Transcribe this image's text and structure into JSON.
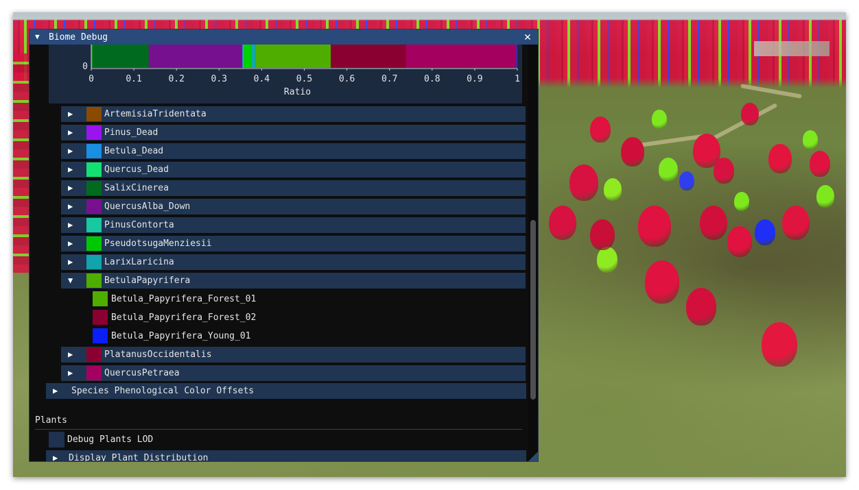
{
  "window": {
    "title": "Biome Debug",
    "close_label": "✕",
    "collapse_arrow": "▼"
  },
  "chart_data": {
    "type": "bar",
    "orientation": "horizontal-stacked",
    "xlabel": "Ratio",
    "xlim": [
      0,
      1
    ],
    "x_ticks": [
      "0",
      "0.1",
      "0.2",
      "0.3",
      "0.4",
      "0.5",
      "0.6",
      "0.7",
      "0.8",
      "0.9",
      "1"
    ],
    "y_tick": "0",
    "segments": [
      {
        "start": 0.0,
        "end": 0.003,
        "color": "#1fa51f"
      },
      {
        "start": 0.003,
        "end": 0.135,
        "color": "#006b1f"
      },
      {
        "start": 0.135,
        "end": 0.355,
        "color": "#77108f"
      },
      {
        "start": 0.355,
        "end": 0.358,
        "color": "#00cfd8"
      },
      {
        "start": 0.358,
        "end": 0.375,
        "color": "#00d200"
      },
      {
        "start": 0.375,
        "end": 0.385,
        "color": "#12a8a8"
      },
      {
        "start": 0.385,
        "end": 0.562,
        "color": "#4fad00"
      },
      {
        "start": 0.562,
        "end": 0.738,
        "color": "#8a0030"
      },
      {
        "start": 0.738,
        "end": 0.998,
        "color": "#a4005f"
      },
      {
        "start": 0.998,
        "end": 1.0,
        "color": "#0a3cf0"
      }
    ]
  },
  "species": [
    {
      "name": "ArtemisiaTridentata",
      "color": "#8a4a00",
      "arrow": "▶"
    },
    {
      "name": "Pinus_Dead",
      "color": "#9a14f0",
      "arrow": "▶"
    },
    {
      "name": "Betula_Dead",
      "color": "#1a8ee0",
      "arrow": "▶"
    },
    {
      "name": "Quercus_Dead",
      "color": "#14e070",
      "arrow": "▶"
    },
    {
      "name": "SalixCinerea",
      "color": "#006b1f",
      "arrow": "▶"
    },
    {
      "name": "QuercusAlba_Down",
      "color": "#77108f",
      "arrow": "▶"
    },
    {
      "name": "PinusContorta",
      "color": "#18c8a0",
      "arrow": "▶"
    },
    {
      "name": "PseudotsugaMenziesii",
      "color": "#00c800",
      "arrow": "▶"
    },
    {
      "name": "LarixLaricina",
      "color": "#12a4aa",
      "arrow": "▶"
    },
    {
      "name": "BetulaPapyrifera",
      "color": "#4fad00",
      "arrow": "▼"
    }
  ],
  "betula_children": [
    {
      "name": "Betula_Papyrifera_Forest_01",
      "color": "#4fad00"
    },
    {
      "name": "Betula_Papyrifera_Forest_02",
      "color": "#8a0030"
    },
    {
      "name": "Betula_Papyrifera_Young_01",
      "color": "#0a1ef5"
    }
  ],
  "species_after": [
    {
      "name": "PlatanusOccidentalis",
      "color": "#8a0030",
      "arrow": "▶"
    },
    {
      "name": "QuercusPetraea",
      "color": "#a4005f",
      "arrow": "▶"
    }
  ],
  "sections": {
    "phenological": {
      "label": "Species Phenological Color Offsets",
      "arrow": "▶"
    },
    "plants_header": "Plants",
    "debug_plants_lod": "Debug Plants LOD",
    "display_plant_distribution": {
      "label": "Display Plant Distribution",
      "arrow": "▶"
    }
  }
}
